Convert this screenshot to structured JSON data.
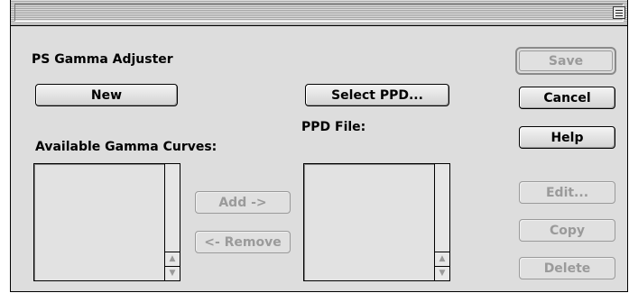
{
  "dialog": {
    "title": "PS Gamma Adjuster",
    "available_label": "Available Gamma Curves:",
    "ppd_label": "PPD File:"
  },
  "buttons": {
    "new": "New",
    "select_ppd": "Select PPD...",
    "add": "Add ->",
    "remove": "<- Remove",
    "save": "Save",
    "cancel": "Cancel",
    "help": "Help",
    "edit": "Edit...",
    "copy": "Copy",
    "delete": "Delete"
  },
  "icons": {
    "scroll_up": "▲",
    "scroll_down": "▼"
  }
}
